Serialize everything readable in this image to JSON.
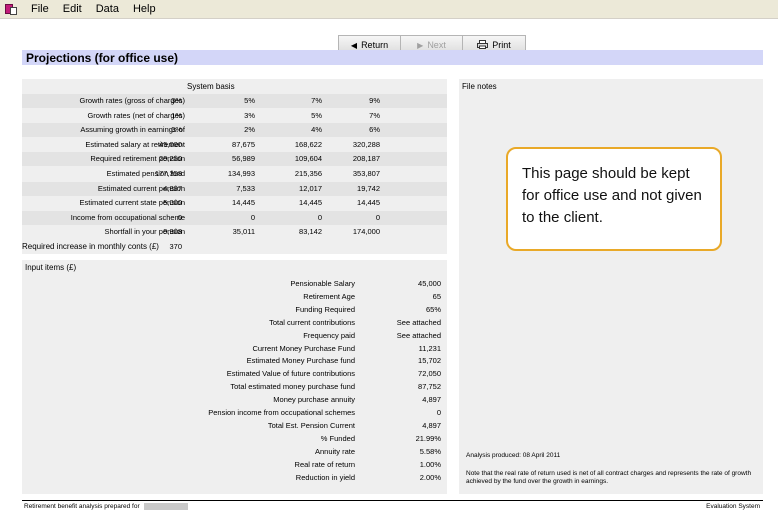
{
  "menu": {
    "file": "File",
    "edit": "Edit",
    "data": "Data",
    "help": "Help"
  },
  "toolbar": {
    "return_label": "Return",
    "next_label": "Next",
    "print_label": "Print"
  },
  "page_title": "Projections (for office use)",
  "system_basis": {
    "header": "System basis",
    "rows": [
      {
        "label": "Growth rates (gross of charges)",
        "values": [
          "3%",
          "5%",
          "7%",
          "9%"
        ]
      },
      {
        "label": "Growth rates (net of charges)",
        "values": [
          "1%",
          "3%",
          "5%",
          "7%"
        ]
      },
      {
        "label": "Assuming growth in earnings of",
        "values": [
          "0%",
          "2%",
          "4%",
          "6%"
        ]
      },
      {
        "label": "Estimated salary at retirement",
        "values": [
          "45,000",
          "87,675",
          "168,622",
          "320,288"
        ]
      },
      {
        "label": "Required retirement pension",
        "values": [
          "29,250",
          "56,989",
          "109,604",
          "208,187"
        ]
      },
      {
        "label": "Estimated pension fund",
        "values": [
          "177,358",
          "134,993",
          "215,356",
          "353,807"
        ]
      },
      {
        "label": "Estimated current pension",
        "values": [
          "4,897",
          "7,533",
          "12,017",
          "19,742"
        ]
      },
      {
        "label": "Estimated current state pension",
        "values": [
          "5,000",
          "14,445",
          "14,445",
          "14,445"
        ]
      },
      {
        "label": "Income from occupational scheme",
        "values": [
          "0",
          "0",
          "0",
          "0"
        ]
      },
      {
        "label": "Shortfall in your pension",
        "values": [
          "9,908",
          "35,011",
          "83,142",
          "174,000"
        ]
      }
    ],
    "monthly_label": "Required increase in monthly conts (£)",
    "monthly_value": "370"
  },
  "input_items": {
    "header": "Input items (£)",
    "rows": [
      {
        "label": "Pensionable Salary",
        "value": "45,000"
      },
      {
        "label": "Retirement Age",
        "value": "65"
      },
      {
        "label": "Funding Required",
        "value": "65%"
      },
      {
        "label": "Total current contributions",
        "value": "See attached"
      },
      {
        "label": "Frequency paid",
        "value": "See attached"
      },
      {
        "label": "Current Money Purchase Fund",
        "value": "11,231"
      },
      {
        "label": "Estimated Money Purchase fund",
        "value": "15,702"
      },
      {
        "label": "Estimated Value of future contributions",
        "value": "72,050"
      },
      {
        "label": "Total estimated money purchase fund",
        "value": "87,752"
      },
      {
        "label": "Money purchase annuity",
        "value": "4,897"
      },
      {
        "label": "Pension income from occupational schemes",
        "value": "0"
      },
      {
        "label": "Total Est. Pension Current",
        "value": "4,897"
      },
      {
        "label": "% Funded",
        "value": "21.99%"
      },
      {
        "label": "Annuity rate",
        "value": "5.58%"
      },
      {
        "label": "Real rate of return",
        "value": "1.00%"
      },
      {
        "label": "Reduction in yield",
        "value": "2.00%"
      }
    ]
  },
  "file_notes": {
    "header": "File notes"
  },
  "callout": {
    "text": "This page should be kept for office use and not given to the client."
  },
  "analysis_date": "Analysis produced: 08 April 2011",
  "note": "Note that the real rate of return used is net of all contract charges and represents the rate of growth achieved by the fund over the growth in earnings.",
  "footer": {
    "left": "Retirement benefit analysis prepared for",
    "right": "Evaluation System"
  }
}
